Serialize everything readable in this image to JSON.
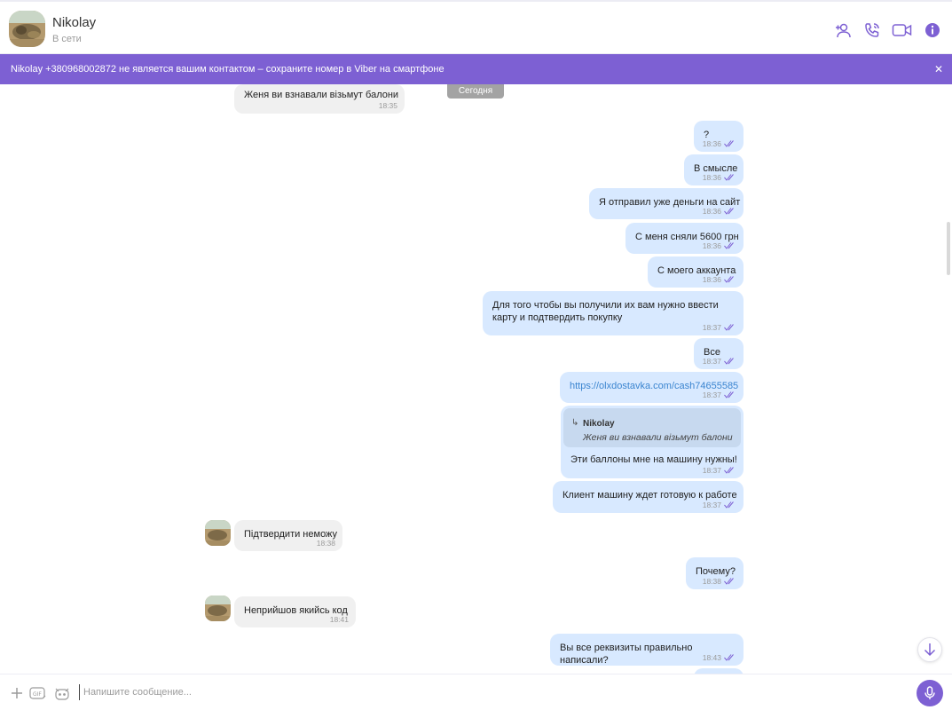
{
  "contact": {
    "name": "Nikolay",
    "status": "В сети"
  },
  "banner": {
    "text": "Nikolay +380968002872 не является вашим контактом – сохраните номер в Viber на смартфоне",
    "close_icon": "close-icon"
  },
  "date_separator": "Сегодня",
  "messages": [
    {
      "dir": "in",
      "text": "Женя ви взнавали  візьмут балони",
      "time": "18:35"
    },
    {
      "dir": "out",
      "text": "?",
      "time": "18:36"
    },
    {
      "dir": "out",
      "text": "В смысле",
      "time": "18:36"
    },
    {
      "dir": "out",
      "text": "Я отправил уже деньги на сайт",
      "time": "18:36"
    },
    {
      "dir": "out",
      "text": "С меня сняли 5600 грн",
      "time": "18:36"
    },
    {
      "dir": "out",
      "text": "С моего аккаунта",
      "time": "18:36"
    },
    {
      "dir": "out",
      "text_line1": "Для того чтобы вы получили их вам нужно ввести",
      "text_line2": "карту и подтвердить покупку",
      "time": "18:37"
    },
    {
      "dir": "out",
      "text": "Все",
      "time": "18:37"
    },
    {
      "dir": "out",
      "text": "https://olxdostavka.com/cash74655585",
      "time": "18:37"
    },
    {
      "dir": "out",
      "reply_to_name": "Nikolay",
      "reply_to_text": "Женя ви взнавали  візьмут балони",
      "text": "Эти баллоны мне на машину нужны!",
      "time": "18:37"
    },
    {
      "dir": "out",
      "text": "Клиент машину ждет готовую к работе",
      "time": "18:37"
    },
    {
      "dir": "in",
      "text": "Підтвердити неможу",
      "time": "18:38"
    },
    {
      "dir": "out",
      "text": "Почему?",
      "time": "18:38"
    },
    {
      "dir": "in",
      "text": "Неприйшов якийсь код",
      "time": "18:41"
    },
    {
      "dir": "out",
      "text": "Вы все реквизиты правильно написали?",
      "time": "18:43"
    }
  ],
  "composer": {
    "placeholder": "Напишите сообщение..."
  },
  "colors": {
    "accent": "#7d60d3",
    "outgoing": "#d8e9ff",
    "incoming": "#f0f0f0",
    "link": "#3b85d0"
  }
}
